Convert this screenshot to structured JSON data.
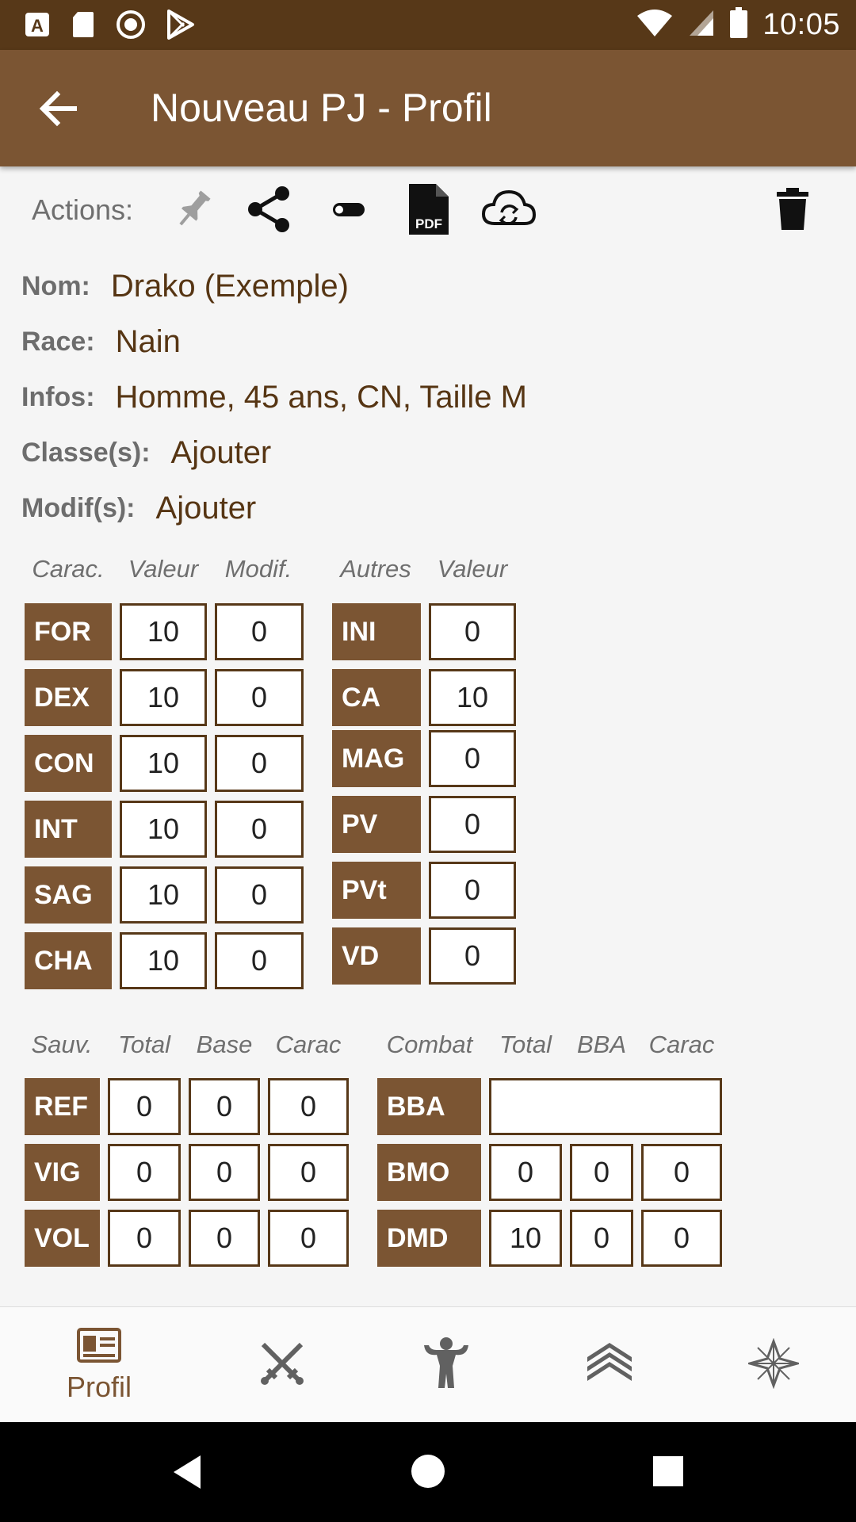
{
  "status_bar": {
    "time": "10:05"
  },
  "app_bar": {
    "title": "Nouveau PJ - Profil"
  },
  "actions": {
    "label": "Actions:"
  },
  "profile": {
    "nom": {
      "label": "Nom:",
      "value": "Drako (Exemple)"
    },
    "race": {
      "label": "Race:",
      "value": "Nain"
    },
    "infos": {
      "label": "Infos:",
      "value": "Homme, 45 ans, CN, Taille M"
    },
    "classes": {
      "label": "Classe(s):",
      "value": "Ajouter"
    },
    "modifs": {
      "label": "Modif(s):",
      "value": "Ajouter"
    }
  },
  "abilities": {
    "headers": [
      "Carac.",
      "Valeur",
      "Modif."
    ],
    "rows": [
      {
        "name": "FOR",
        "value": "10",
        "mod": "0"
      },
      {
        "name": "DEX",
        "value": "10",
        "mod": "0"
      },
      {
        "name": "CON",
        "value": "10",
        "mod": "0"
      },
      {
        "name": "INT",
        "value": "10",
        "mod": "0"
      },
      {
        "name": "SAG",
        "value": "10",
        "mod": "0"
      },
      {
        "name": "CHA",
        "value": "10",
        "mod": "0"
      }
    ]
  },
  "others": {
    "headers": [
      "Autres",
      "Valeur"
    ],
    "rows": [
      {
        "name": "INI",
        "value": "0"
      },
      {
        "name": "CA",
        "value": "10"
      },
      {
        "name": "MAG",
        "value": "0"
      },
      {
        "name": "PV",
        "value": "0"
      },
      {
        "name": "PVt",
        "value": "0"
      },
      {
        "name": "VD",
        "value": "0"
      }
    ]
  },
  "saves": {
    "headers": [
      "Sauv.",
      "Total",
      "Base",
      "Carac"
    ],
    "rows": [
      {
        "name": "REF",
        "total": "0",
        "base": "0",
        "carac": "0"
      },
      {
        "name": "VIG",
        "total": "0",
        "base": "0",
        "carac": "0"
      },
      {
        "name": "VOL",
        "total": "0",
        "base": "0",
        "carac": "0"
      }
    ]
  },
  "combat": {
    "headers": [
      "Combat",
      "Total",
      "BBA",
      "Carac"
    ],
    "rows": [
      {
        "name": "BBA",
        "value": ""
      },
      {
        "name": "BMO",
        "total": "0",
        "bba": "0",
        "carac": "0"
      },
      {
        "name": "DMD",
        "total": "10",
        "bba": "0",
        "carac": "0"
      }
    ]
  },
  "bottom_nav": {
    "active_label": "Profil",
    "items": [
      "profile-card-icon",
      "crossed-swords-icon",
      "strongman-icon",
      "chevrons-up-icon",
      "star-icon"
    ]
  },
  "colors": {
    "brand_dark": "#573818",
    "brand": "#7b5533"
  }
}
